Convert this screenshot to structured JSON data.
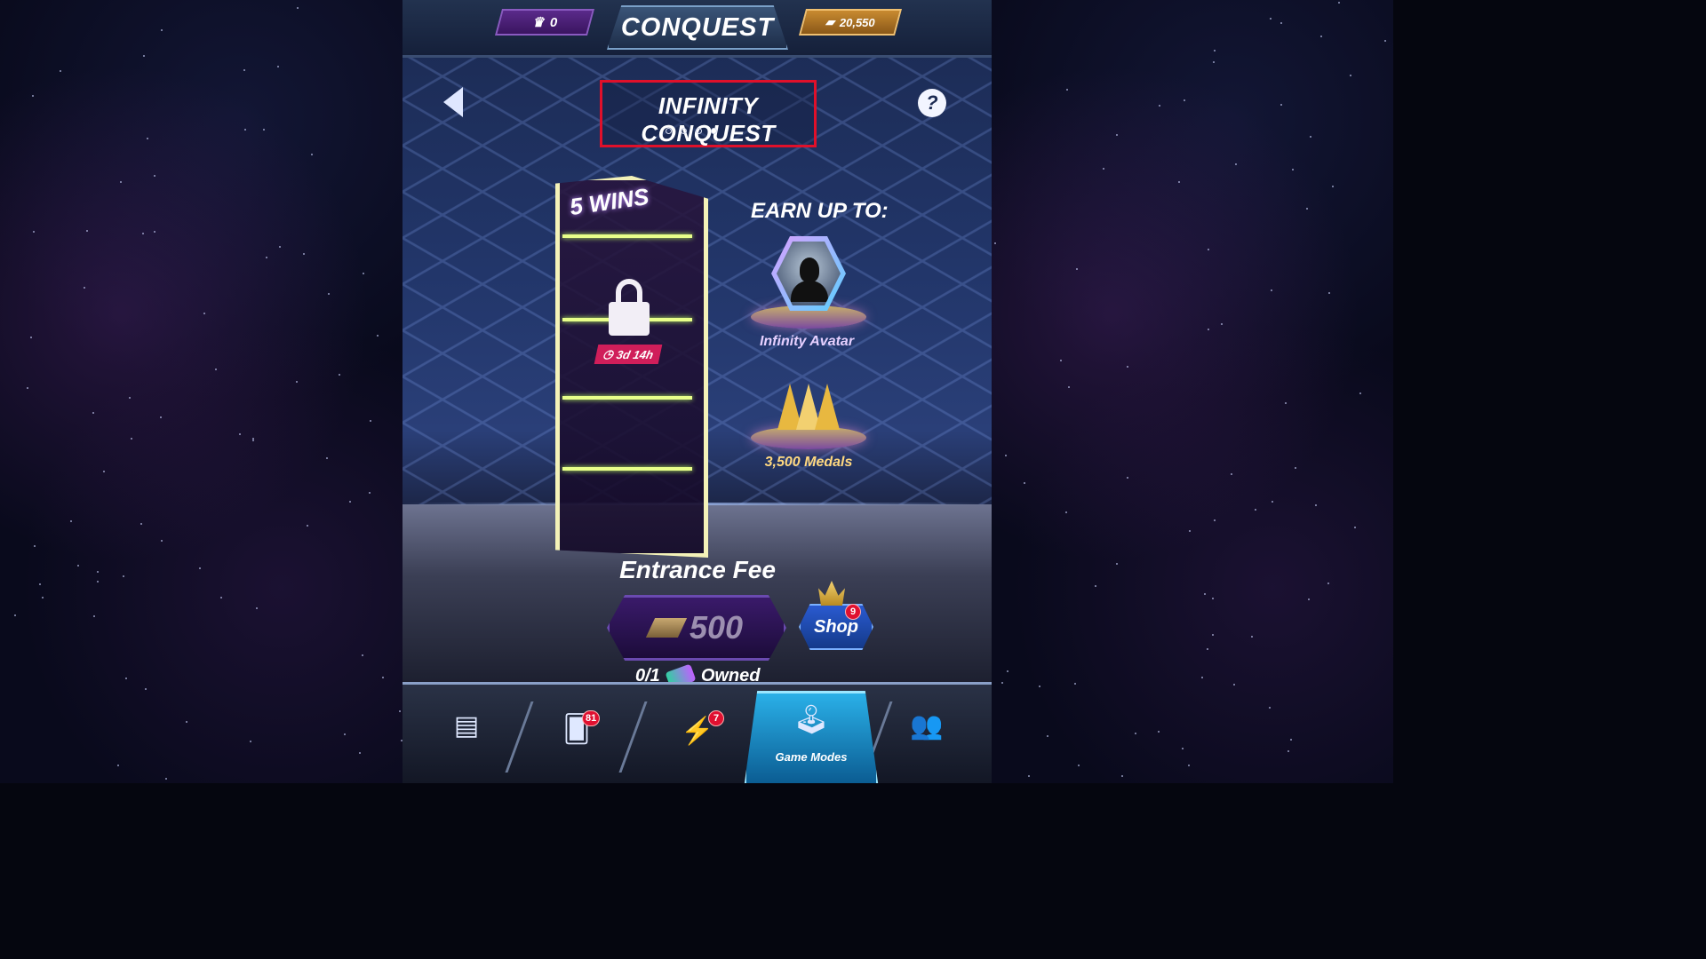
{
  "top_bar": {
    "medals_value": "0",
    "title": "CONQUEST",
    "gold_value": "20,550"
  },
  "header": {
    "mode_title": "INFINITY CONQUEST",
    "page_dots": {
      "total": 4,
      "active_index": 3
    },
    "help_label": "?"
  },
  "portal": {
    "wins_label": "5 WINS",
    "timer": "3d 14h",
    "locked": true
  },
  "rewards": {
    "heading": "EARN UP TO:",
    "items": [
      {
        "label": "Infinity Avatar",
        "icon": "avatar-icon"
      },
      {
        "label": "3,500 Medals",
        "icon": "medal-crown-icon"
      }
    ]
  },
  "entrance": {
    "title": "Entrance Fee",
    "fee_value": "500",
    "shop_label": "Shop",
    "shop_badge": "9",
    "owned_count": "0/1",
    "owned_label": "Owned"
  },
  "nav": {
    "items": [
      {
        "name": "gold-bars",
        "icon": "gold-bars-icon",
        "badge": ""
      },
      {
        "name": "cards",
        "icon": "cards-icon",
        "badge": "81"
      },
      {
        "name": "teams",
        "icon": "teams-icon",
        "badge": "7"
      },
      {
        "name": "game-modes",
        "icon": "joystick-icon",
        "label": "Game Modes",
        "active": true
      },
      {
        "name": "alliance",
        "icon": "alliance-icon",
        "badge": ""
      }
    ]
  },
  "colors": {
    "highlight_border": "#e0102a",
    "active_tab": "#2ab0e8",
    "badge": "#e01030"
  }
}
